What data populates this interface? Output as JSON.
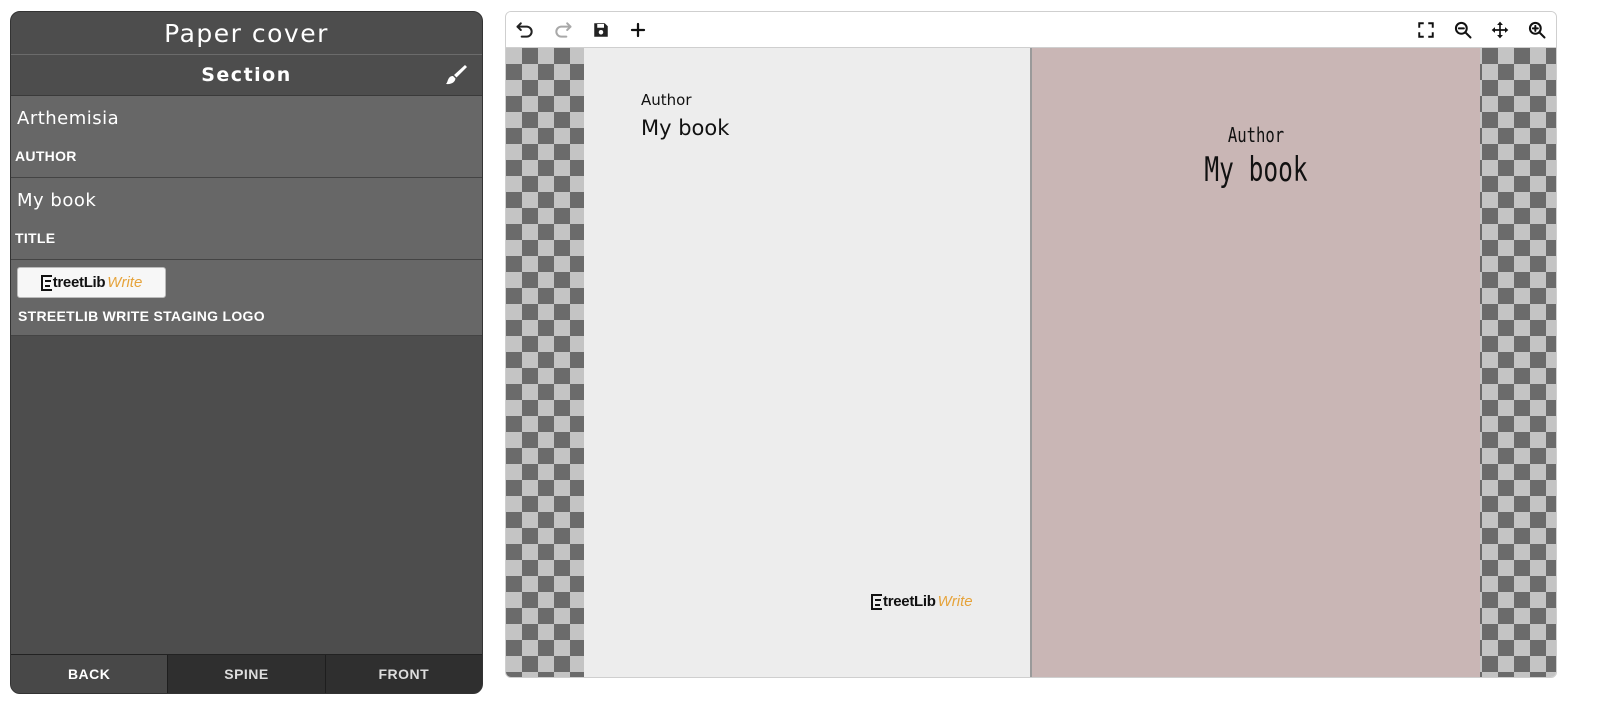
{
  "panel": {
    "title": "Paper cover",
    "section_title": "Section",
    "fields": {
      "author_value": "Arthemisia",
      "author_label": "AUTHOR",
      "title_value": "My book",
      "title_label": "TITLE",
      "logo_label": "STREETLIB WRITE STAGING LOGO"
    },
    "footer_tabs": [
      "BACK",
      "SPINE",
      "FRONT"
    ],
    "active_tab": "BACK"
  },
  "logo": {
    "street": "treetLib",
    "write": "Write"
  },
  "toolbar": {
    "left_icons": [
      "undo-icon",
      "redo-icon",
      "save-icon",
      "plus-icon"
    ],
    "right_icons": [
      "fullscreen-icon",
      "zoom-out-icon",
      "move-icon",
      "zoom-in-icon"
    ]
  },
  "canvas": {
    "back": {
      "author": "Author",
      "title": "My book"
    },
    "front": {
      "author": "Author",
      "title": "My book"
    },
    "colors": {
      "back_cover": "#ededed",
      "front_cover": "#c9b6b5",
      "logo_accent": "#e6a33a"
    }
  }
}
